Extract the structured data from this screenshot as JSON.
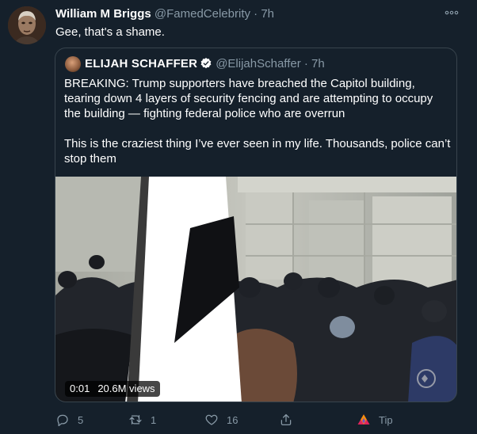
{
  "tweet": {
    "author_name": "William M Briggs",
    "handle": "@FamedCelebrity",
    "separator": "·",
    "time": "7h",
    "text": "Gee, that's a shame."
  },
  "quoted": {
    "author_name": "ELIJAH SCHAFFER",
    "handle": "@ElijahSchaffer",
    "separator": "·",
    "time": "7h",
    "paragraph_1": "BREAKING: Trump supporters have breached the Capitol building, tearing down 4 layers of security fencing and are attempting to occupy the building — fighting federal police who are overrun",
    "paragraph_2": "This is the craziest thing I’ve ever seen in my life. Thousands, police can’t stop them",
    "video": {
      "timestamp": "0:01",
      "views": "20.6M views"
    }
  },
  "actions": {
    "reply_count": "5",
    "retweet_count": "1",
    "like_count": "16",
    "tip_label": "Tip"
  },
  "colors": {
    "background": "#15202b",
    "secondary_text": "#8899a6",
    "border": "#38444d",
    "verified": "#ffffff"
  }
}
